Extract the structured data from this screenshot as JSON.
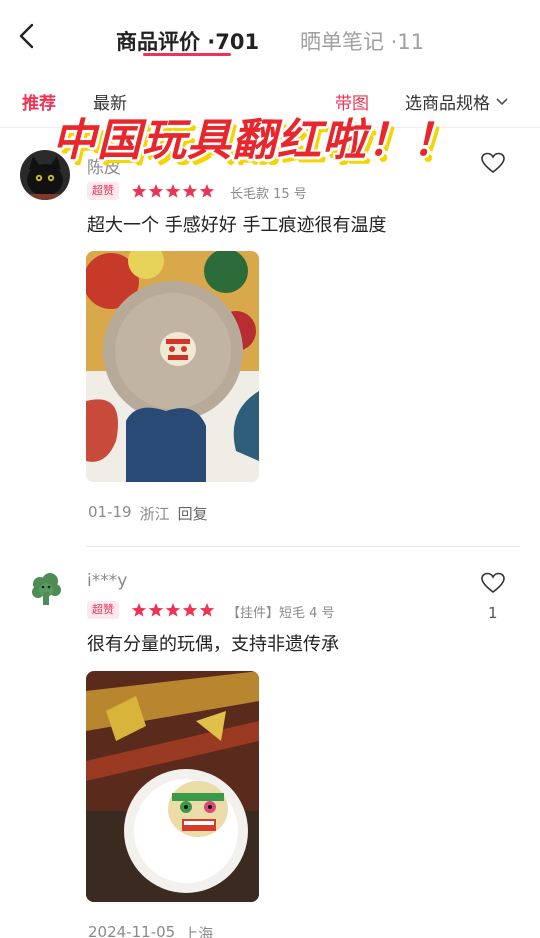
{
  "header": {
    "tab_reviews": "商品评价 ·701",
    "tab_notes": "晒单笔记 ·11"
  },
  "filters": {
    "recommended": "推荐",
    "latest": "最新",
    "with_images": "带图",
    "choose_spec": "选商品规格"
  },
  "overlay": {
    "headline": "中国玩具翻红啦！！"
  },
  "colors": {
    "accent": "#ee3355",
    "headline_red": "#e8262b",
    "headline_shadow": "#f5d400",
    "muted": "#8a8a8a"
  },
  "reviews": [
    {
      "username": "陈皮",
      "badge": "超赞",
      "rating": 5,
      "spec": "长毛款 15 号",
      "content": "超大一个 手感好好 手工痕迹很有温度",
      "date": "01-19",
      "location": "浙江",
      "reply": "回复",
      "like_count": ""
    },
    {
      "username": "i***y",
      "badge": "超赞",
      "rating": 5,
      "spec": "【挂件】短毛 4 号",
      "content": "很有分量的玩偶，支持非遗传承",
      "date": "2024-11-05",
      "location": "上海",
      "reply": "",
      "like_count": "1"
    }
  ]
}
